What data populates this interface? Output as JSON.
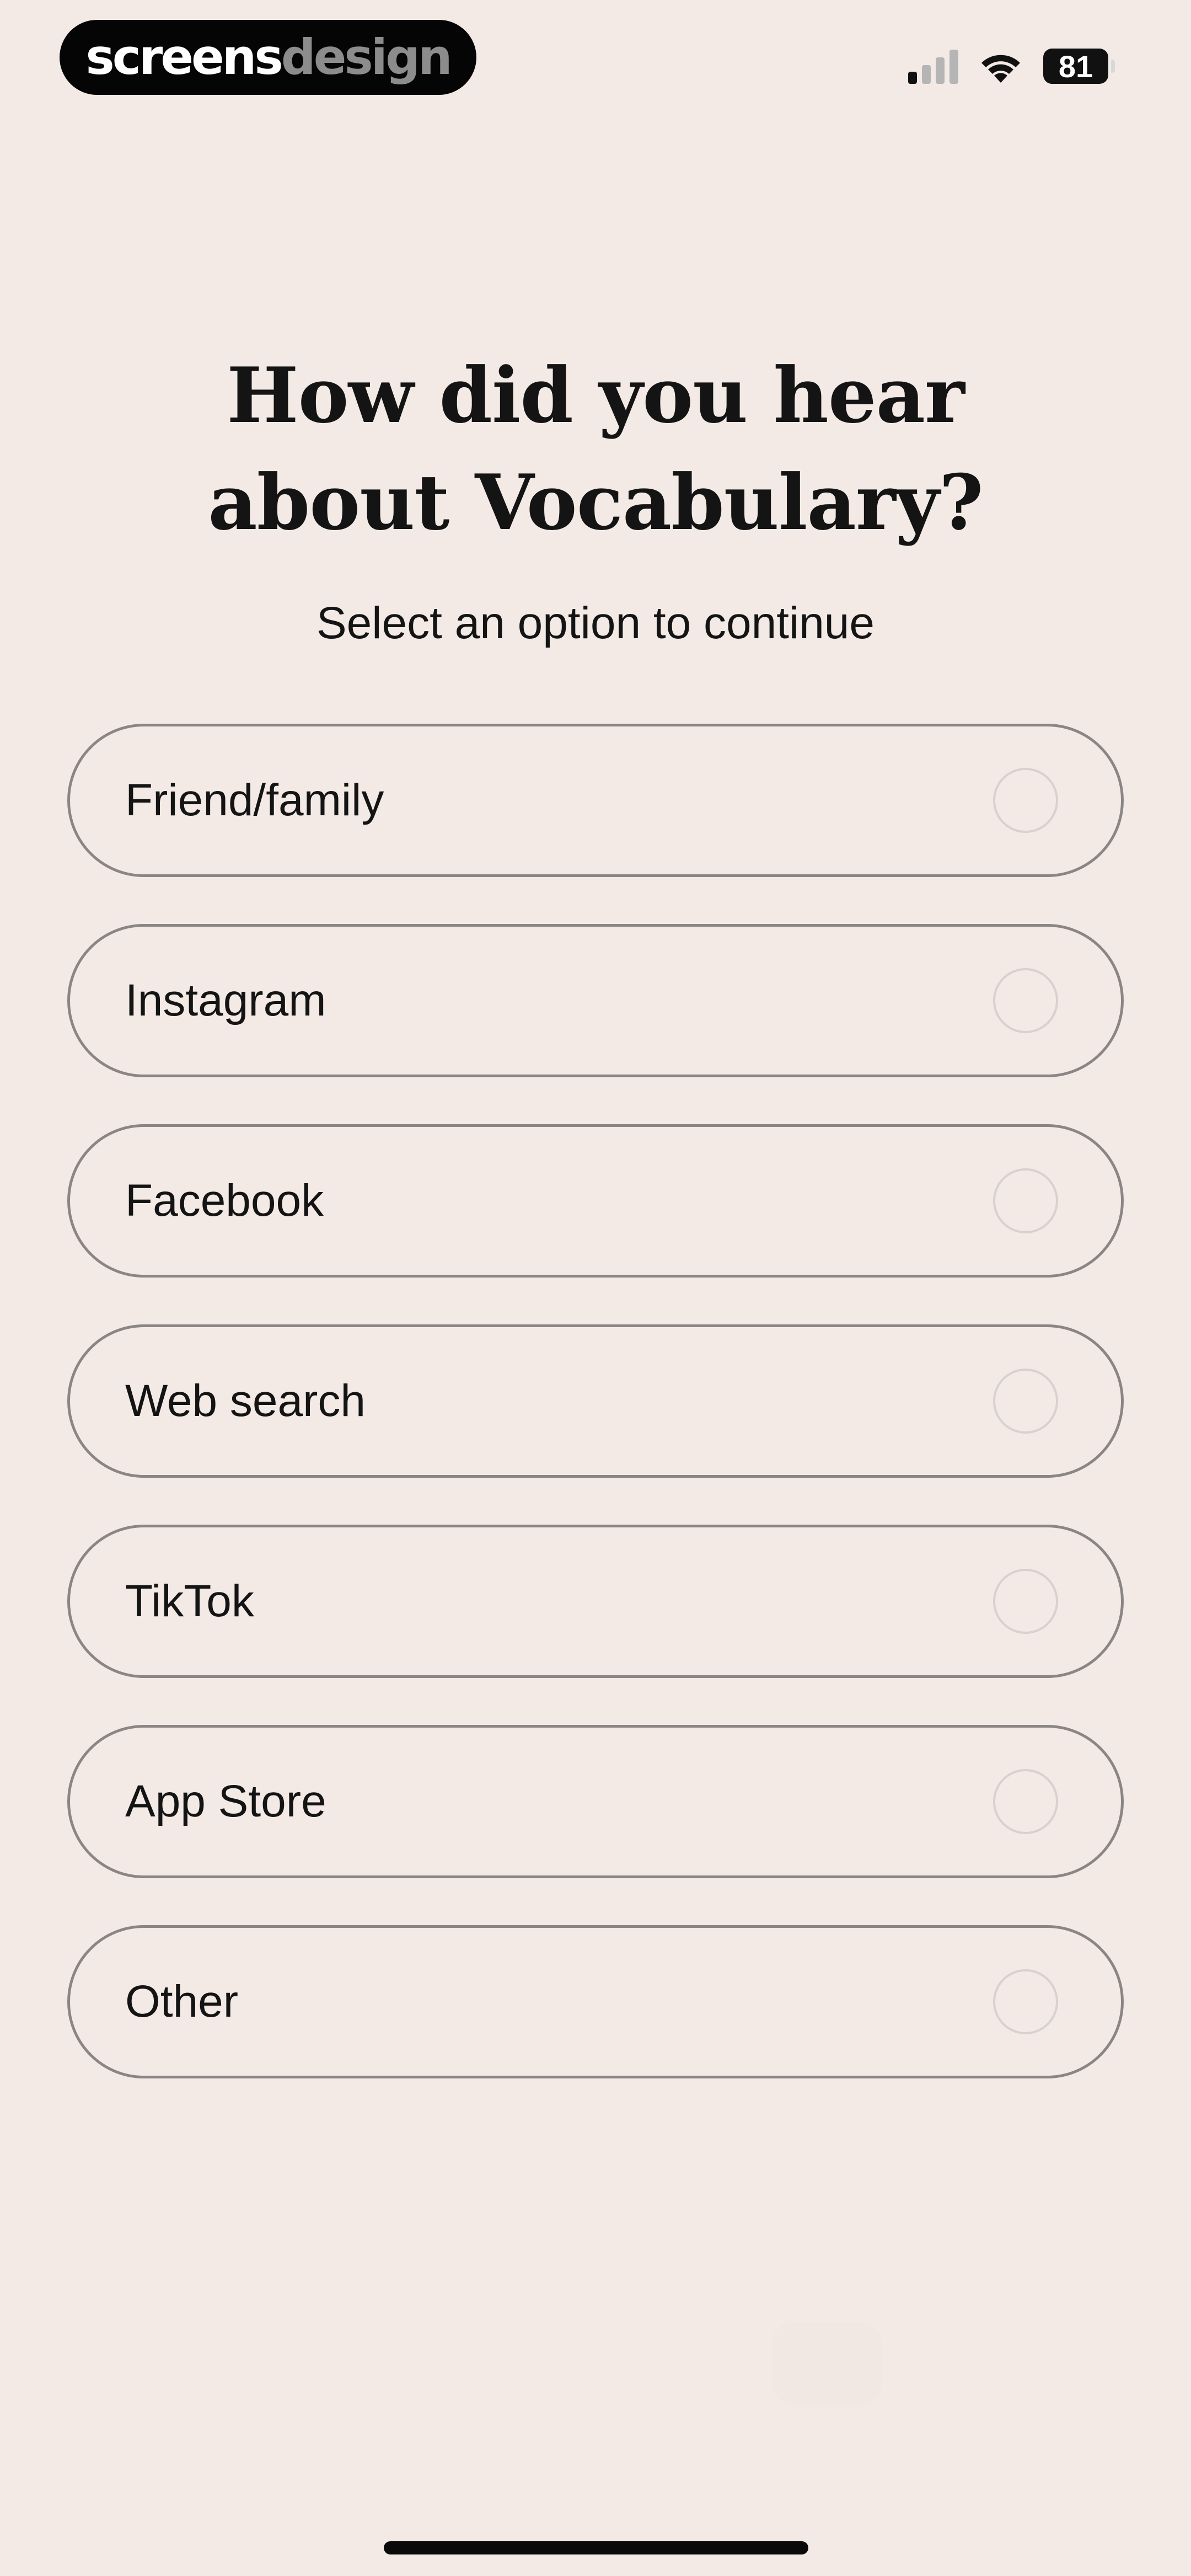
{
  "brand": {
    "part1": "screens",
    "part2": "design"
  },
  "status_bar": {
    "battery": "81",
    "signal_bars_active": 1,
    "signal_bars_total": 4
  },
  "heading": {
    "line1": "How did you hear",
    "line2": "about Vocabulary?"
  },
  "subtitle": "Select an option to continue",
  "options": [
    {
      "label": "Friend/family",
      "selected": false
    },
    {
      "label": "Instagram",
      "selected": false
    },
    {
      "label": "Facebook",
      "selected": false
    },
    {
      "label": "Web search",
      "selected": false
    },
    {
      "label": "TikTok",
      "selected": false
    },
    {
      "label": "App Store",
      "selected": false
    },
    {
      "label": "Other",
      "selected": false
    }
  ],
  "colors": {
    "background": "#f3eae6",
    "option_border": "#8b8583",
    "radio_border": "#d9d1ce",
    "text": "#141414"
  }
}
